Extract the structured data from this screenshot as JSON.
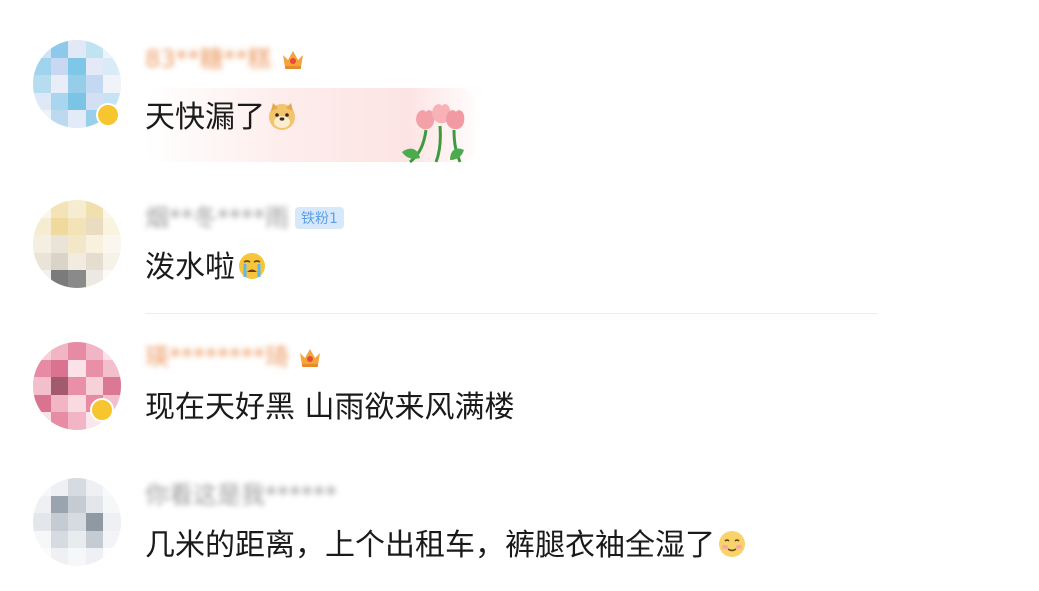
{
  "comments": [
    {
      "id": 1,
      "username": "83**糖**糕",
      "avatar_colors": [
        "#7fc7e8",
        "#c9d7f2",
        "#9fd3ee",
        "#e4e9f7",
        "#bfe3f3"
      ],
      "badge": "crown-icon",
      "text": "天快漏了",
      "emoji": "doge-emoji",
      "decoration": "tulip-bubble"
    },
    {
      "id": 2,
      "username": "烟**冬****雨",
      "avatar_colors": [
        "#f3e3b6",
        "#f6ecd1",
        "#e9e3d8",
        "#7b7b7b",
        "#faf3df"
      ],
      "fan_badge": "铁粉1",
      "text": "泼水啦",
      "emoji": "crying-emoji"
    },
    {
      "id": 3,
      "username": "瑛********琦",
      "avatar_colors": [
        "#f2b5c6",
        "#e78aa4",
        "#f7d0da",
        "#d9738f",
        "#fbe1e8"
      ],
      "badge": "crown-icon",
      "text": "现在天好黑 山雨欲来风满楼"
    },
    {
      "id": 4,
      "username": "你看这是我******",
      "avatar_colors": [
        "#d6dbe1",
        "#eef0f3",
        "#9aa4ae",
        "#f6f7f9",
        "#c4cbd3"
      ],
      "text": "几米的距离，上个出租车，裤腿衣袖全湿了",
      "emoji": "smile-emoji"
    }
  ]
}
